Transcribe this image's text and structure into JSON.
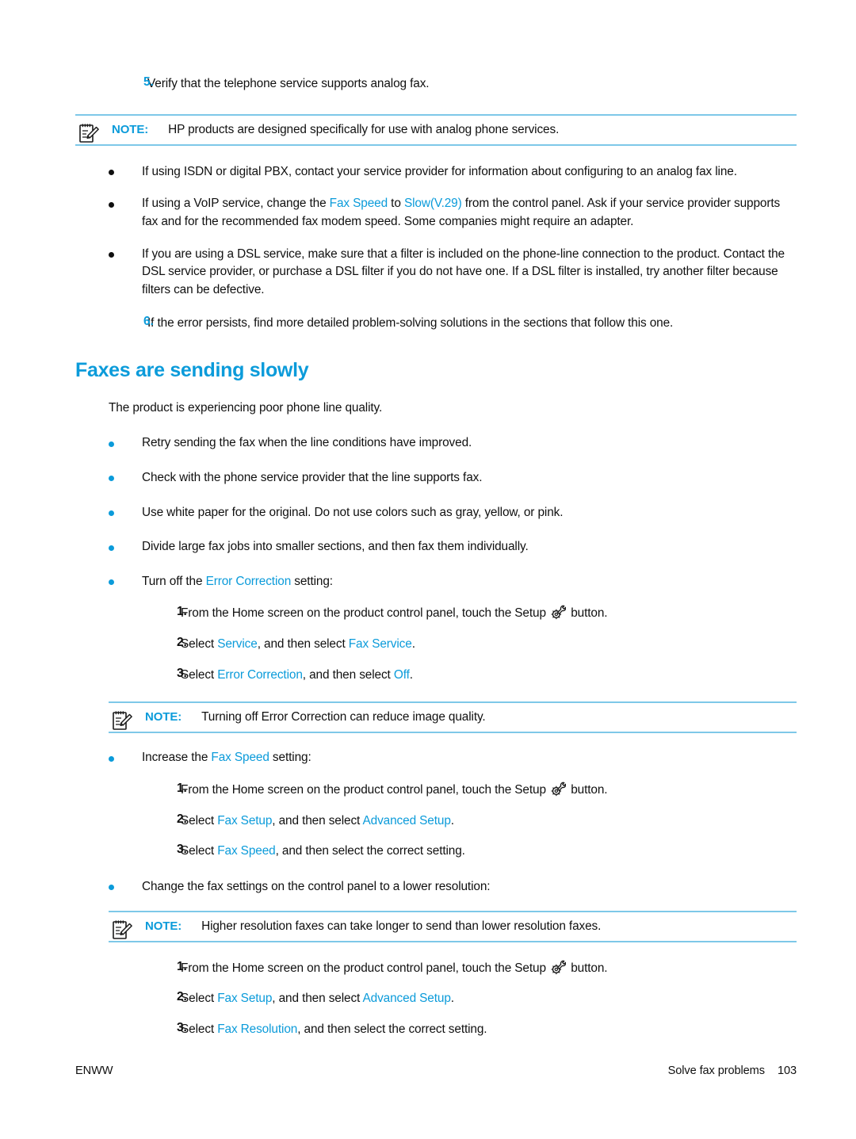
{
  "document": {
    "footer": {
      "left_label": "ENWW",
      "section_title": "Solve fax problems",
      "page_number": "103"
    },
    "colors": {
      "accent_blue": "#0b9bda",
      "note_rule": "#7ec8e8",
      "body_text": "#101010"
    }
  },
  "steps_top": {
    "item5": {
      "number": "5.",
      "text": "Verify that the telephone service supports analog fax."
    },
    "note1": {
      "label": "NOTE:",
      "text": "HP products are designed specifically for use with analog phone services."
    },
    "bullets": [
      {
        "text": "If using ISDN or digital PBX, contact your service provider for information about configuring to an analog fax line."
      },
      {
        "pre": "If using a VoIP service, change the ",
        "term1": "Fax Speed",
        "mid": " to ",
        "term2": "Slow(V.29)",
        "post": " from the control panel. Ask if your service provider supports fax and for the recommended fax modem speed. Some companies might require an adapter."
      },
      {
        "text": "If you are using a DSL service, make sure that a filter is included on the phone-line connection to the product. Contact the DSL service provider, or purchase a DSL filter if you do not have one. If a DSL filter is installed, try another filter because filters can be defective."
      }
    ],
    "item6": {
      "number": "6.",
      "text": "If the error persists, find more detailed problem-solving solutions in the sections that follow this one."
    }
  },
  "section": {
    "heading": "Faxes are sending slowly",
    "intro": "The product is experiencing poor phone line quality.",
    "bullets": {
      "b1": "Retry sending the fax when the line conditions have improved.",
      "b2": "Check with the phone service provider that the line supports fax.",
      "b3": "Use white paper for the original. Do not use colors such as gray, yellow, or pink.",
      "b4": "Divide large fax jobs into smaller sections, and then fax them individually.",
      "b5": {
        "pre": "Turn off the ",
        "term": "Error Correction",
        "post": " setting:"
      },
      "b6": {
        "pre": "Increase the ",
        "term": "Fax Speed",
        "post": " setting:"
      },
      "b7": "Change the fax settings on the control panel to a lower resolution:"
    },
    "error_correction_steps": {
      "s1": {
        "number": "1.",
        "pre": "From the Home screen on the product control panel, touch the Setup ",
        "post": " button.",
        "icon": "setup-wrench-gear-icon"
      },
      "s2": {
        "number": "2.",
        "pre": "Select ",
        "term1": "Service",
        "mid": ", and then select ",
        "term2": "Fax Service",
        "post": "."
      },
      "s3": {
        "number": "3.",
        "pre": "Select ",
        "term1": "Error Correction",
        "mid": ", and then select ",
        "term2": "Off",
        "post": "."
      }
    },
    "note2": {
      "label": "NOTE:",
      "text": "Turning off Error Correction can reduce image quality."
    },
    "fax_speed_steps": {
      "s1": {
        "number": "1.",
        "pre": "From the Home screen on the product control panel, touch the Setup ",
        "post": " button.",
        "icon": "setup-wrench-gear-icon"
      },
      "s2": {
        "number": "2.",
        "pre": "Select ",
        "term1": "Fax Setup",
        "mid": ", and then select ",
        "term2": "Advanced Setup",
        "post": "."
      },
      "s3": {
        "number": "3.",
        "pre": "Select ",
        "term1": "Fax Speed",
        "mid": ", and then select the correct setting.",
        "term2": "",
        "post": ""
      }
    },
    "note3": {
      "label": "NOTE:",
      "text": "Higher resolution faxes can take longer to send than lower resolution faxes."
    },
    "resolution_steps": {
      "s1": {
        "number": "1.",
        "pre": "From the Home screen on the product control panel, touch the Setup ",
        "post": " button.",
        "icon": "setup-wrench-gear-icon"
      },
      "s2": {
        "number": "2.",
        "pre": "Select ",
        "term1": "Fax Setup",
        "mid": ", and then select ",
        "term2": "Advanced Setup",
        "post": "."
      },
      "s3": {
        "number": "3.",
        "pre": "Select ",
        "term1": "Fax Resolution",
        "mid": ", and then select the correct setting.",
        "term2": "",
        "post": ""
      }
    }
  }
}
